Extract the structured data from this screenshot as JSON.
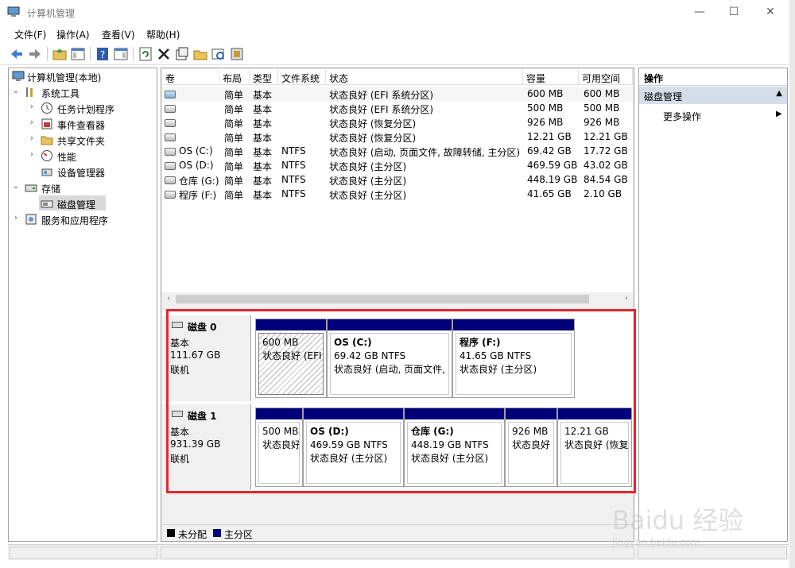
{
  "window": {
    "title": "计算机管理",
    "min_icon": "—",
    "max_icon": "☐",
    "close_icon": "✕"
  },
  "menu": [
    "文件(F)",
    "操作(A)",
    "查看(V)",
    "帮助(H)"
  ],
  "toolbar_icons": [
    "back-arrow-icon",
    "forward-arrow-icon",
    "up-folder-icon",
    "show-hide-tree-icon",
    "help-icon",
    "properties-pane-icon",
    "refresh-icon",
    "delete-icon",
    "properties-icon",
    "open-folder-icon",
    "search-disk-icon",
    "disk-settings-icon"
  ],
  "tree": {
    "root": "计算机管理(本地)",
    "system_tools": "系统工具",
    "task_scheduler": "任务计划程序",
    "event_viewer": "事件查看器",
    "shared_folders": "共享文件夹",
    "performance": "性能",
    "device_manager": "设备管理器",
    "storage": "存储",
    "disk_management": "磁盘管理",
    "services_apps": "服务和应用程序"
  },
  "volume_table": {
    "columns": [
      "卷",
      "布局",
      "类型",
      "文件系统",
      "状态",
      "容量",
      "可用空间"
    ],
    "rows": [
      {
        "vol": "",
        "layout": "简单",
        "type": "基本",
        "fs": "",
        "status": "状态良好 (EFI 系统分区)",
        "cap": "600 MB",
        "free": "600 MB"
      },
      {
        "vol": "",
        "layout": "简单",
        "type": "基本",
        "fs": "",
        "status": "状态良好 (EFI 系统分区)",
        "cap": "500 MB",
        "free": "500 MB"
      },
      {
        "vol": "",
        "layout": "简单",
        "type": "基本",
        "fs": "",
        "status": "状态良好 (恢复分区)",
        "cap": "926 MB",
        "free": "926 MB"
      },
      {
        "vol": "",
        "layout": "简单",
        "type": "基本",
        "fs": "",
        "status": "状态良好 (恢复分区)",
        "cap": "12.21 GB",
        "free": "12.21 GB"
      },
      {
        "vol": "OS (C:)",
        "layout": "简单",
        "type": "基本",
        "fs": "NTFS",
        "status": "状态良好 (启动, 页面文件, 故障转储, 主分区)",
        "cap": "69.42 GB",
        "free": "17.72 GB"
      },
      {
        "vol": "OS (D:)",
        "layout": "简单",
        "type": "基本",
        "fs": "NTFS",
        "status": "状态良好 (主分区)",
        "cap": "469.59 GB",
        "free": "43.02 GB"
      },
      {
        "vol": "仓库 (G:)",
        "layout": "简单",
        "type": "基本",
        "fs": "NTFS",
        "status": "状态良好 (主分区)",
        "cap": "448.19 GB",
        "free": "84.54 GB"
      },
      {
        "vol": "程序 (F:)",
        "layout": "简单",
        "type": "基本",
        "fs": "NTFS",
        "status": "状态良好 (主分区)",
        "cap": "41.65 GB",
        "free": "2.10 GB"
      }
    ]
  },
  "disks": [
    {
      "name": "磁盘 0",
      "type": "基本",
      "size": "111.67 GB",
      "state": "联机",
      "partitions": [
        {
          "title": "",
          "size": "600 MB",
          "status": "状态良好 (EFI",
          "hatched": true
        },
        {
          "title": "OS  (C:)",
          "size": "69.42 GB NTFS",
          "status": "状态良好 (启动, 页面文件,"
        },
        {
          "title": "程序  (F:)",
          "size": "41.65 GB NTFS",
          "status": "状态良好 (主分区)"
        }
      ]
    },
    {
      "name": "磁盘 1",
      "type": "基本",
      "size": "931.39 GB",
      "state": "联机",
      "partitions": [
        {
          "title": "",
          "size": "500 MB",
          "status": "状态良好"
        },
        {
          "title": "OS  (D:)",
          "size": "469.59 GB NTFS",
          "status": "状态良好 (主分区)"
        },
        {
          "title": "仓库  (G:)",
          "size": "448.19 GB NTFS",
          "status": "状态良好 (主分区)"
        },
        {
          "title": "",
          "size": "926 MB",
          "status": "状态良好"
        },
        {
          "title": "",
          "size": "12.21 GB",
          "status": "状态良好 (恢复"
        }
      ]
    }
  ],
  "legend": {
    "unallocated": "未分配",
    "primary": "主分区",
    "unallocated_color": "#000000",
    "primary_color": "#00007b"
  },
  "actions": {
    "header": "操作",
    "section": "磁盘管理",
    "more": "更多操作"
  },
  "watermark": {
    "main": "Baidu 经验",
    "sub": "jingyan.baidu.com"
  },
  "colors": {
    "highlight": "#e8242e",
    "partition_bar": "#00007b"
  }
}
